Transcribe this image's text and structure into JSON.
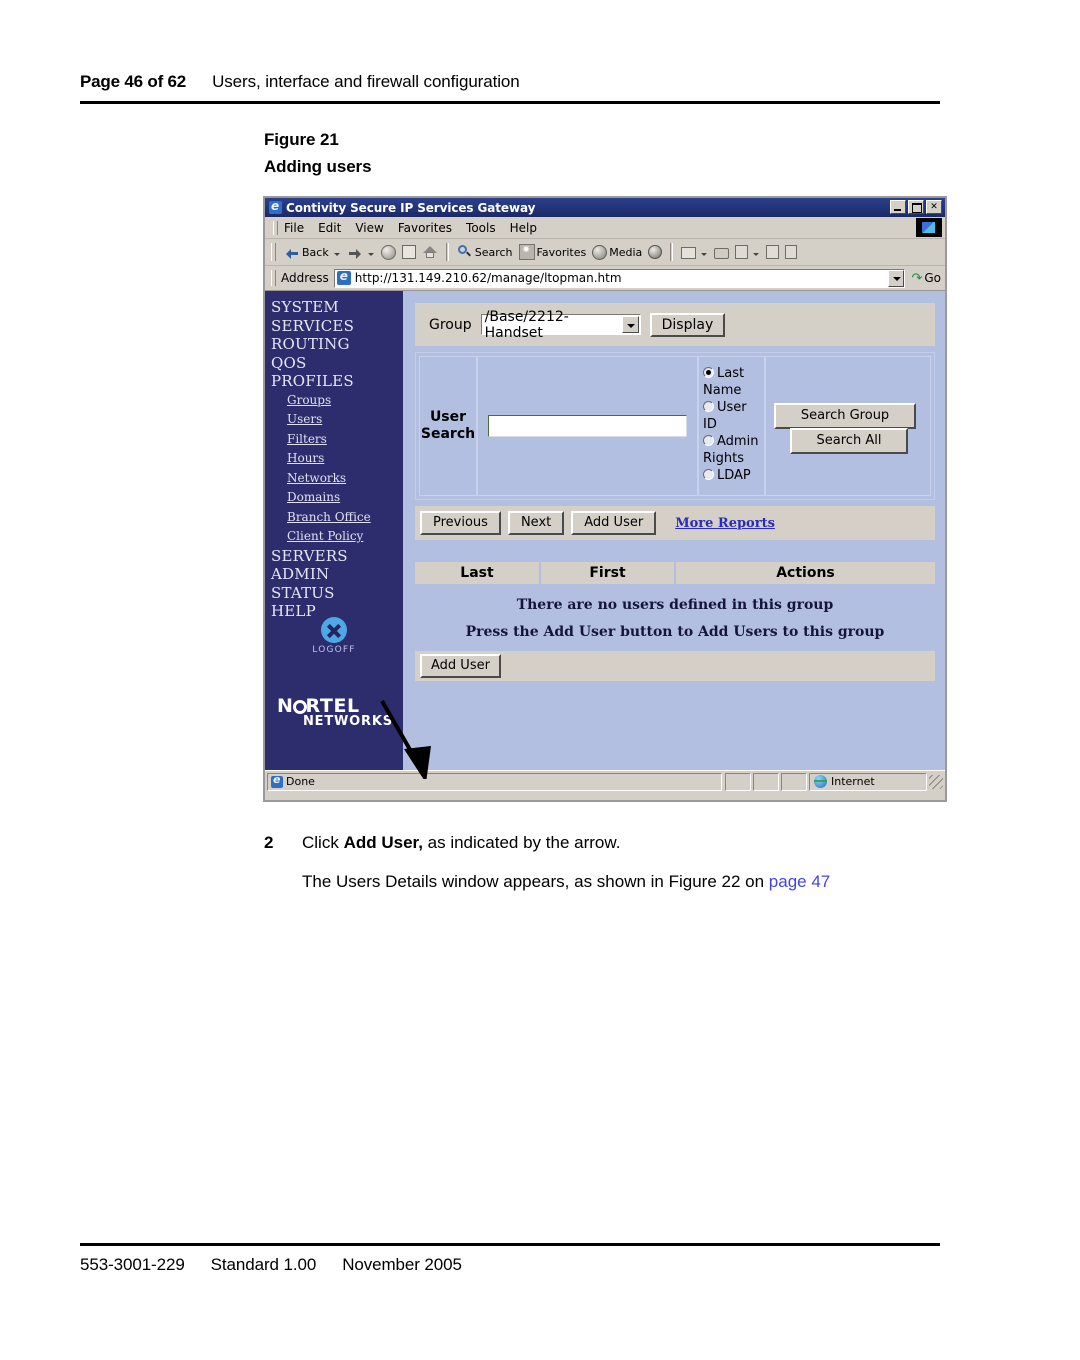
{
  "header": {
    "folio": "Page 46 of 62",
    "chapter_title": "Users, interface and firewall configuration"
  },
  "figure": {
    "label": "Figure 21",
    "title": "Adding users"
  },
  "browser": {
    "window_title": "Contivity Secure IP Services Gateway",
    "window_controls": {
      "minimize": "_",
      "maximize": "□",
      "close": "✕"
    },
    "menu": [
      "File",
      "Edit",
      "View",
      "Favorites",
      "Tools",
      "Help"
    ],
    "toolbar": {
      "back": "Back",
      "forward": "",
      "stop": "",
      "refresh": "",
      "home": "",
      "search": "Search",
      "favorites": "Favorites",
      "media": "Media",
      "history": "",
      "mail": "",
      "print": "",
      "edit": "",
      "discuss": "",
      "messenger": ""
    },
    "address": {
      "label": "Address",
      "url": "http://131.149.210.62/manage/ltopman.htm",
      "go_label": "Go"
    },
    "status": {
      "text": "Done",
      "zone": "Internet"
    }
  },
  "sidebar": {
    "main_items": [
      "SYSTEM",
      "SERVICES",
      "ROUTING",
      "QOS",
      "PROFILES"
    ],
    "sub_items": [
      "Groups",
      "Users",
      "Filters",
      "Hours",
      "Networks",
      "Domains",
      "Branch Office",
      "Client Policy"
    ],
    "main_items_2": [
      "SERVERS",
      "ADMIN",
      "STATUS",
      "HELP"
    ],
    "logoff_label": "LOGOFF",
    "brand_line1": "NORTEL",
    "brand_line2": "NETWORKS"
  },
  "app": {
    "group_row": {
      "label": "Group",
      "selected_value": "/Base/2212-Handset",
      "display_button": "Display"
    },
    "user_search": {
      "label_line1": "User",
      "label_line2": "Search",
      "input_value": "",
      "radios": [
        {
          "label": "Last Name",
          "selected": true
        },
        {
          "label": "User ID",
          "selected": false
        },
        {
          "label": "Admin Rights",
          "selected": false
        },
        {
          "label": "LDAP",
          "selected": false
        }
      ],
      "search_group_button": "Search Group",
      "search_all_button": "Search All"
    },
    "action_row": {
      "previous": "Previous",
      "next": "Next",
      "add_user": "Add User",
      "more_reports_link": "More Reports"
    },
    "results": {
      "columns": [
        "Last",
        "First",
        "Actions"
      ],
      "empty_message_1": "There are no users defined in this group",
      "empty_message_2": "Press the Add User button to Add Users to this group",
      "add_user_button": "Add User"
    }
  },
  "caption": {
    "step_number": "2",
    "step_text_pre": "Click ",
    "step_text_bold": "Add User,",
    "step_text_post": " as indicated by the arrow.",
    "follow_text": "The Users Details window appears, as shown in Figure 22 on ",
    "follow_link": "page 47"
  },
  "footer": {
    "doc_number": "553-3001-229",
    "standard": "Standard 1.00",
    "date": "November 2005"
  },
  "colors": {
    "sidebar_navy": "#2d2d6e",
    "content_blue": "#b2bfe1",
    "chrome_gray": "#d4d0c8",
    "title_blue": "#1b2a66",
    "link_blue": "#2a2ac0",
    "page_link": "#4444dd"
  }
}
